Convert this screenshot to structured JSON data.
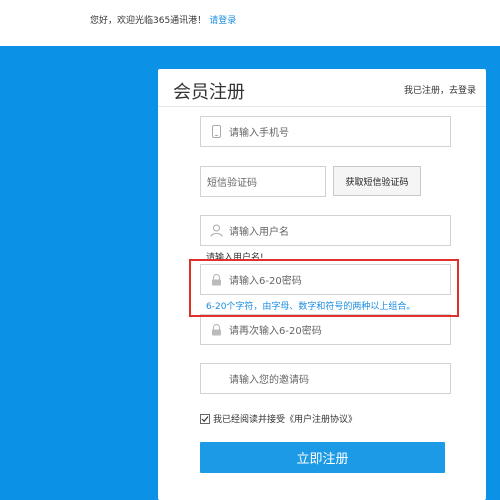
{
  "header": {
    "welcome_text": "您好，欢迎光临365通讯港！",
    "login_link": "请登录"
  },
  "card": {
    "title": "会员注册",
    "login_link": "我已注册，去登录"
  },
  "form": {
    "phone_placeholder": "请输入手机号",
    "sms_code_placeholder": "短信验证码",
    "get_code_label": "获取短信验证码",
    "username_placeholder": "请输入用户名",
    "username_error": "请输入用户名!",
    "password_placeholder": "请输入6-20密码",
    "password_hint": "6-20个字符，由字母、数字和符号的两种以上组合。",
    "confirm_password_placeholder": "请再次输入6-20密码",
    "invite_code_placeholder": "请输入您的邀请码",
    "agreement_text": "我已经阅读并接受《用户注册协议》",
    "agreement_checked": true,
    "submit_label": "立即注册"
  },
  "colors": {
    "page_background": "#0b92e6",
    "accent": "#1c9ae6",
    "highlight_border": "#e0302a",
    "hint_text": "#1c8de0"
  }
}
